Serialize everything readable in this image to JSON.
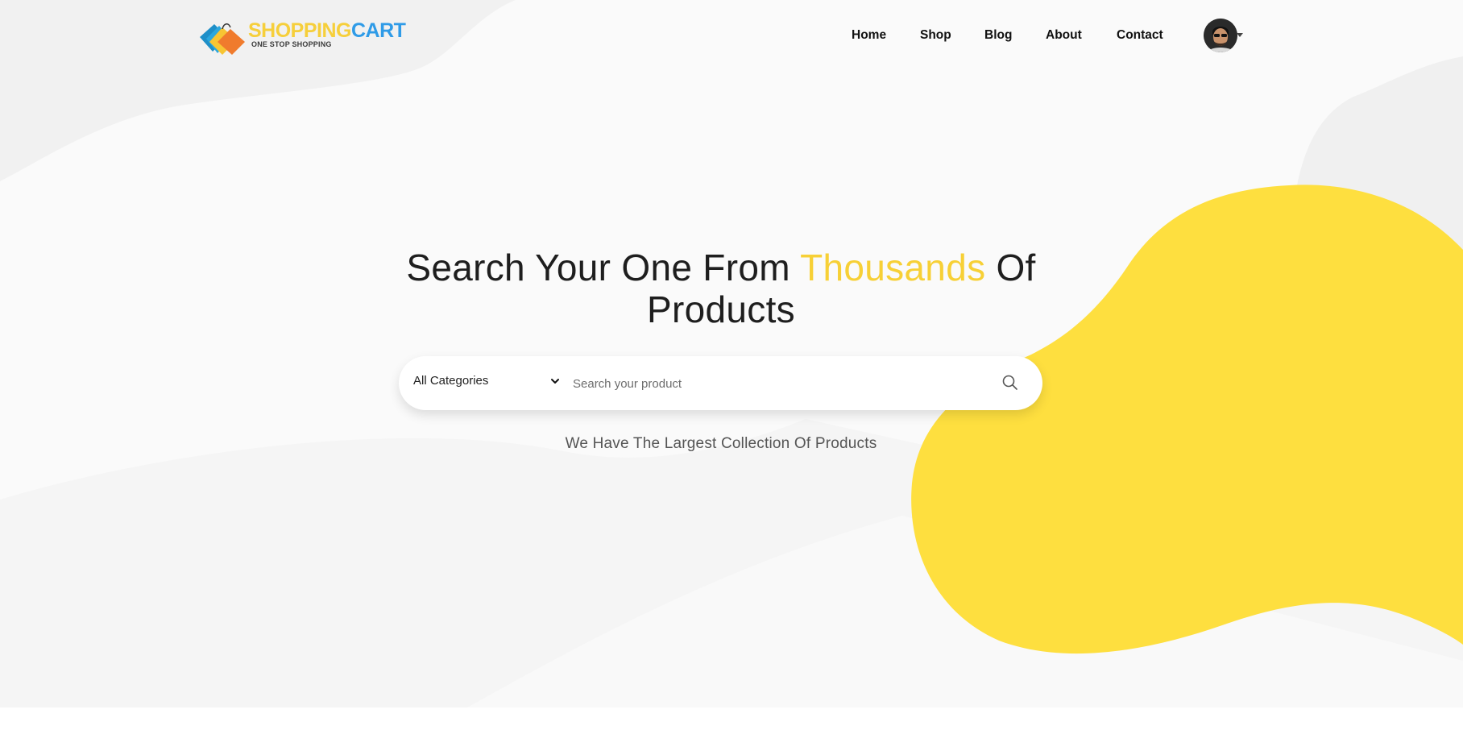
{
  "brand": {
    "name_part1": "SHOPPING",
    "name_part2": "CART",
    "tagline": "ONE STOP SHOPPING",
    "colors": {
      "yellow": "#f6cf3b",
      "blue": "#2f9be7",
      "orange": "#f07b2d",
      "teal": "#1e8fc8"
    }
  },
  "nav": {
    "items": [
      {
        "label": "Home"
      },
      {
        "label": "Shop"
      },
      {
        "label": "Blog"
      },
      {
        "label": "About"
      },
      {
        "label": "Contact"
      }
    ],
    "avatar_icon": "user-avatar-icon"
  },
  "hero": {
    "headline_before": "Search Your One From ",
    "headline_highlight": "Thousands",
    "headline_after": " Of",
    "headline_line2": "Products",
    "subtitle": "We Have The Largest Collection Of Products",
    "accent_color": "#fedf3f"
  },
  "search": {
    "category_selected": "All Categories",
    "placeholder": "Search your product",
    "value": "",
    "button_icon": "search-icon"
  }
}
